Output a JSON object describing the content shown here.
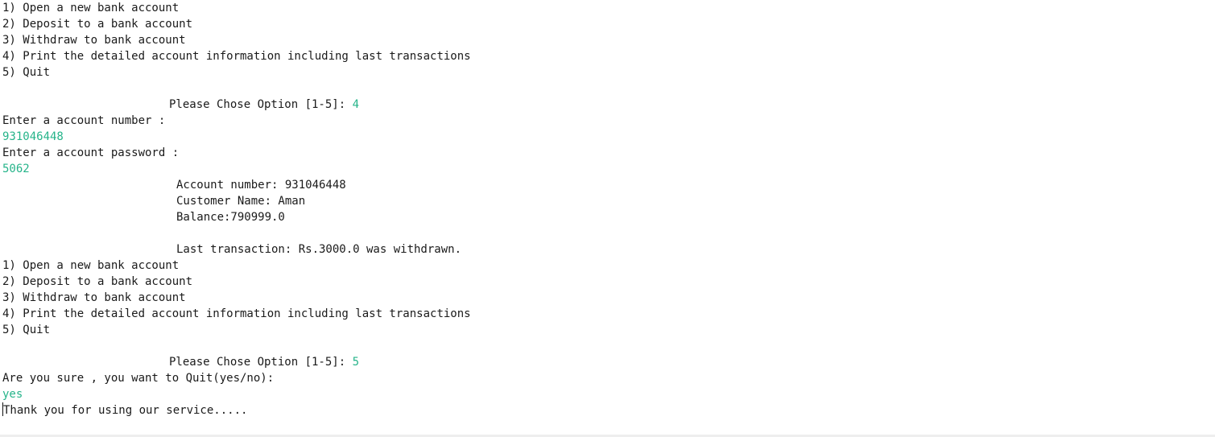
{
  "menu1": {
    "items": [
      "1) Open a new bank account",
      "2) Deposit to a bank account",
      "3) Withdraw to bank account",
      "4) Print the detailed account information including last transactions",
      "5) Quit"
    ]
  },
  "prompt1": {
    "label": "Please Chose Option [1-5]: ",
    "input": "4"
  },
  "account_prompt": {
    "label": "Enter a account number :",
    "input": "931046448"
  },
  "password_prompt": {
    "label": "Enter a account password :",
    "input": "5062"
  },
  "details": {
    "account_number": "Account number: 931046448",
    "customer_name": "Customer Name: Aman",
    "balance": "Balance:790999.0",
    "last_transaction": "Last transaction: Rs.3000.0 was withdrawn."
  },
  "menu2": {
    "items": [
      "1) Open a new bank account",
      "2) Deposit to a bank account",
      "3) Withdraw to bank account",
      "4) Print the detailed account information including last transactions",
      "5) Quit"
    ]
  },
  "prompt2": {
    "label": "Please Chose Option [1-5]: ",
    "input": "5"
  },
  "quit_prompt": {
    "label": "Are you sure , you want to Quit(yes/no):",
    "input": "yes"
  },
  "farewell": "Thank you for using our service.....",
  "colors": {
    "input_text": "#26b48a",
    "output_text": "#1a1a1a",
    "background": "#ffffff"
  }
}
